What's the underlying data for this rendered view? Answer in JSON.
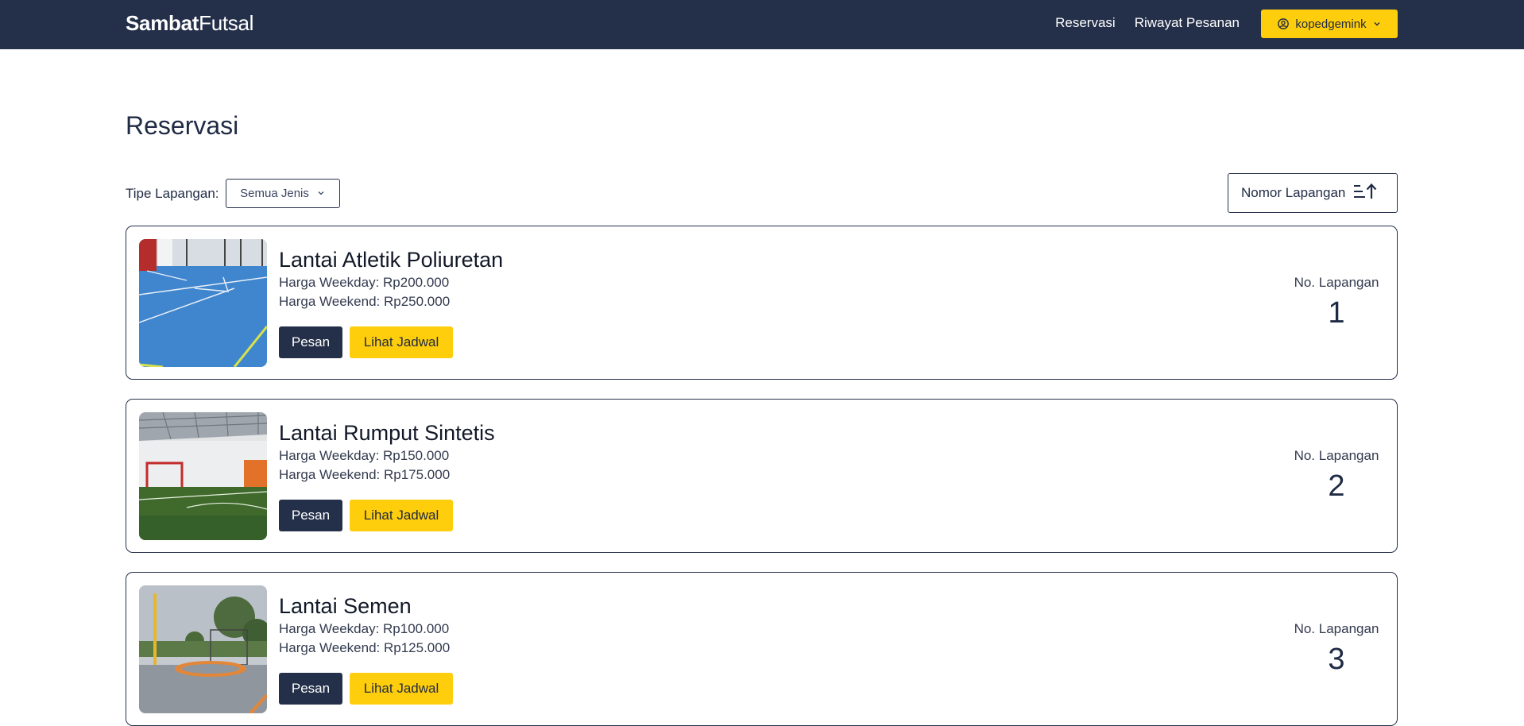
{
  "navbar": {
    "brand_bold": "Sambat",
    "brand_light": "Futsal",
    "links": [
      "Reservasi",
      "Riwayat Pesanan"
    ],
    "user": {
      "name": "kopedgemink",
      "icon": "user-circle-icon"
    },
    "bg_color": "#243049",
    "accent_color": "#fecd0b"
  },
  "page": {
    "title": "Reservasi"
  },
  "filter": {
    "label": "Tipe Lapangan:",
    "selected": "Semua Jenis"
  },
  "sort": {
    "label": "Nomor Lapangan",
    "icon": "sort-ascending-icon"
  },
  "courts": [
    {
      "name": "Lantai Atletik Poliuretan",
      "weekday": "Harga Weekday: Rp200.000",
      "weekend": "Harga Weekend: Rp250.000",
      "book_label": "Pesan",
      "schedule_label": "Lihat Jadwal",
      "number_label": "No. Lapangan",
      "number": "1"
    },
    {
      "name": "Lantai Rumput Sintetis",
      "weekday": "Harga Weekday: Rp150.000",
      "weekend": "Harga Weekend: Rp175.000",
      "book_label": "Pesan",
      "schedule_label": "Lihat Jadwal",
      "number_label": "No. Lapangan",
      "number": "2"
    },
    {
      "name": "Lantai Semen",
      "weekday": "Harga Weekday: Rp100.000",
      "weekend": "Harga Weekend: Rp125.000",
      "book_label": "Pesan",
      "schedule_label": "Lihat Jadwal",
      "number_label": "No. Lapangan",
      "number": "3"
    }
  ]
}
